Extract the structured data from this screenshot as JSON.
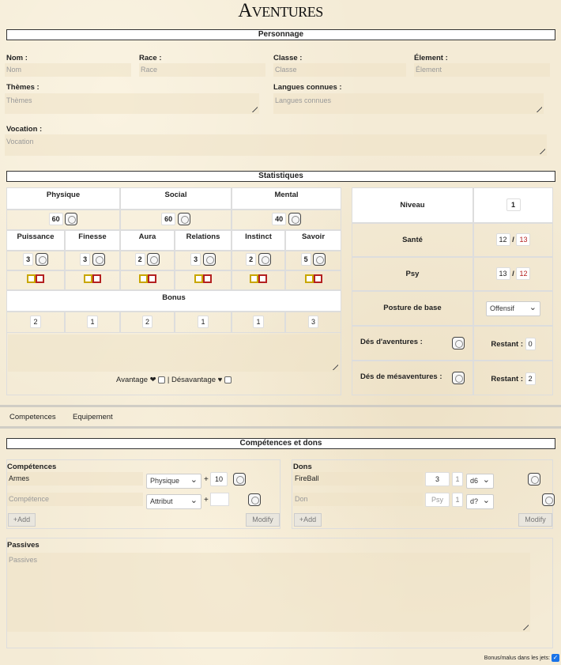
{
  "title": "Aventures",
  "sections": {
    "personnage": "Personnage",
    "statistiques": "Statistiques",
    "competences_dons": "Compétences et dons"
  },
  "character": {
    "nom_label": "Nom :",
    "nom_placeholder": "Nom",
    "race_label": "Race :",
    "race_placeholder": "Race",
    "classe_label": "Classe :",
    "classe_placeholder": "Classe",
    "element_label": "Élement :",
    "element_placeholder": "Élement",
    "themes_label": "Thèmes :",
    "themes_placeholder": "Thèmes",
    "langues_label": "Langues connues :",
    "langues_placeholder": "Langues connues",
    "vocation_label": "Vocation :",
    "vocation_placeholder": "Vocation"
  },
  "stats": {
    "main": [
      {
        "label": "Physique",
        "value": "60"
      },
      {
        "label": "Social",
        "value": "60"
      },
      {
        "label": "Mental",
        "value": "40"
      }
    ],
    "sub": [
      {
        "label": "Puissance",
        "value": "3",
        "bonus": "2"
      },
      {
        "label": "Finesse",
        "value": "3",
        "bonus": "1"
      },
      {
        "label": "Aura",
        "value": "2",
        "bonus": "2"
      },
      {
        "label": "Relations",
        "value": "3",
        "bonus": "1"
      },
      {
        "label": "Instinct",
        "value": "2",
        "bonus": "1"
      },
      {
        "label": "Savoir",
        "value": "5",
        "bonus": "3"
      }
    ],
    "bonus_label": "Bonus",
    "avantage_label": "Avantage",
    "separator": "|",
    "desavantage_label": "Désavantage"
  },
  "side": {
    "niveau_label": "Niveau",
    "niveau_value": "1",
    "sante_label": "Santé",
    "sante_current": "12",
    "sante_max": "13",
    "psy_label": "Psy",
    "psy_current": "13",
    "psy_max": "12",
    "slash": "/",
    "posture_label": "Posture de base",
    "posture_value": "Offensif",
    "des_aventures_label": "Dés d'aventures :",
    "restant_label": "Restant :",
    "des_aventures_restant": "0",
    "des_mesaventures_label": "Dés de mésaventures :",
    "des_mesaventures_restant": "2"
  },
  "tabs": [
    "Competences",
    "Equipement"
  ],
  "competences": {
    "header": "Compétences",
    "rows": [
      {
        "name": "Armes",
        "attr": "Physique",
        "plus": "+",
        "value": "10"
      }
    ],
    "new_placeholder": "Compétence",
    "new_attr": "Attribut",
    "add_label": "+Add",
    "modify_label": "Modify"
  },
  "dons": {
    "header": "Dons",
    "rows": [
      {
        "name": "FireBall",
        "cost": "3",
        "count": "1",
        "die": "d6"
      }
    ],
    "new_placeholder": "Don",
    "new_cost_placeholder": "Psy",
    "new_count": "1",
    "new_die": "d?",
    "add_label": "+Add",
    "modify_label": "Modify"
  },
  "passives": {
    "label": "Passives",
    "placeholder": "Passives"
  },
  "footer": {
    "bonus_label": "Bonus/malus dans les jets:",
    "checked": true
  },
  "colors": {
    "accent_red": "#b42020",
    "accent_yellow": "#c8a600"
  }
}
